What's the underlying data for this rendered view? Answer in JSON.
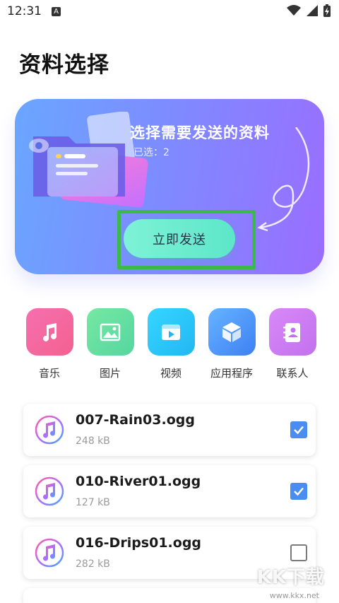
{
  "status_bar": {
    "time": "12:31",
    "notification_glyph": "A",
    "icons": [
      "wifi-icon",
      "cell-signal-icon",
      "battery-charging-icon"
    ]
  },
  "page": {
    "title": "资料选择"
  },
  "hero": {
    "title": "选择需要发送的资料",
    "selected_label": "已选：2",
    "send_button_label": "立即发送",
    "highlight_color": "#3cb94a"
  },
  "categories": [
    {
      "label": "音乐",
      "icon": "music-note-icon"
    },
    {
      "label": "图片",
      "icon": "image-icon"
    },
    {
      "label": "视频",
      "icon": "video-icon"
    },
    {
      "label": "应用程序",
      "icon": "cube-icon"
    },
    {
      "label": "联系人",
      "icon": "contacts-book-icon"
    }
  ],
  "files": [
    {
      "name": "007-Rain03.ogg",
      "size": "248 kB",
      "checked": true
    },
    {
      "name": "010-River01.ogg",
      "size": "127 kB",
      "checked": true
    },
    {
      "name": "016-Drips01.ogg",
      "size": "282 kB",
      "checked": false
    }
  ],
  "watermark": {
    "text": "KK下载",
    "url": "www.kkx.net"
  },
  "colors": {
    "accent_checkbox": "#4a8cf0",
    "send_button": "#6eecd0"
  }
}
